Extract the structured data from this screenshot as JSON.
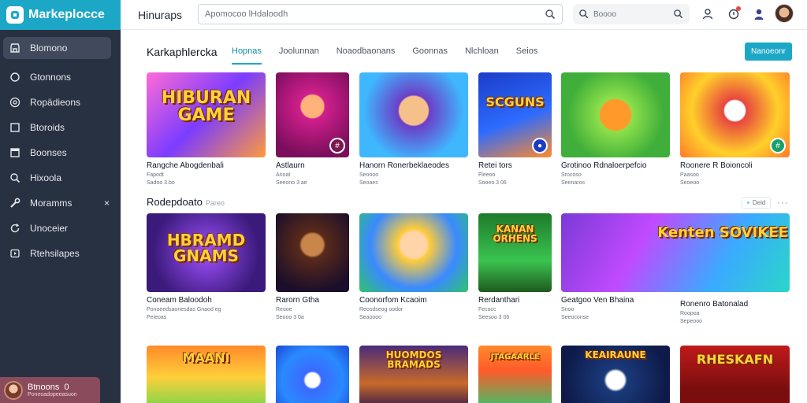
{
  "brand": {
    "name": "Markeplocce"
  },
  "sidebar": {
    "items": [
      {
        "label": "Blomono",
        "icon": "store-icon"
      },
      {
        "label": "Gtonnons",
        "icon": "circle-icon"
      },
      {
        "label": "Ropädieons",
        "icon": "target-icon"
      },
      {
        "label": "Btoroids",
        "icon": "square-icon"
      },
      {
        "label": "Boonses",
        "icon": "window-icon"
      },
      {
        "label": "Hixoola",
        "icon": "search-icon"
      },
      {
        "label": "Moramms",
        "icon": "wrench-icon",
        "extra": "×"
      },
      {
        "label": "Unoceier",
        "icon": "refresh-icon"
      },
      {
        "label": "Rtehsilapes",
        "icon": "play-icon"
      }
    ],
    "profile": {
      "name": "Btnoons",
      "badge": "0",
      "sub": "Poneoadopeeasuon"
    }
  },
  "topbar": {
    "title": "Hinuraps",
    "search_placeholder": "Apomocoo lHdaloodh",
    "search2_placeholder": "Boooo"
  },
  "main": {
    "title": "Karkaphlercka",
    "tabs": [
      "Hopnas",
      "Joolunnan",
      "Noaodbaonans",
      "Goonnas",
      "Nlchloan",
      "Seios"
    ],
    "action_label": "Nanoeonr",
    "section2_title": "Rodepdoato",
    "section2_sub": "Pareo",
    "section2_pill": "Deid"
  },
  "cards_row1": [
    {
      "title": "Rangche Abogdenbali",
      "sub": "Fapodt",
      "meta": "Sadoo 3.bo",
      "art": "HIBURAN GAME"
    },
    {
      "title": "Astlaurn",
      "sub": "Anoat",
      "meta": "Seeono 3 ae",
      "art": ""
    },
    {
      "title": "Hanorn Ronerbeklaeodes",
      "sub": "Seoooo",
      "meta": "Seoaes",
      "art": ""
    },
    {
      "title": "Retei tors",
      "sub": "Fleeoo",
      "meta": "Sooeo 3 06",
      "art": "SCGUNS"
    },
    {
      "title": "Grotinoo Rdnaloerpefcio",
      "sub": "Srocoso",
      "meta": "Seenaros",
      "art": ""
    },
    {
      "title": "Roonere R Boioncoli",
      "sub": "Paasoo",
      "meta": "Seoeoo",
      "art": ""
    }
  ],
  "cards_row2": [
    {
      "title": "Coneam Baloodoh",
      "sub": "Ponoeedsaonesdas Gnaod eg",
      "meta": "Peieoas",
      "art": "HBRAMD GNAMS"
    },
    {
      "title": "Rarorn Gtha",
      "sub": "Reooe",
      "meta": "Seooo 3 0a",
      "art": ""
    },
    {
      "title": "Coonorfom Kcaoim",
      "sub": "Reosdseog oodor",
      "meta": "Seaoooo",
      "art": ""
    },
    {
      "title": "Rerdanthari",
      "sub": "Fecocc",
      "meta": "Seesoo 3 06",
      "art": "KANAN ORHENS"
    },
    {
      "title": "Geatgoo Ven Bhaina",
      "sub": "Snoo",
      "meta": "Seeoconse",
      "art": "Kenten SOVIKEE"
    },
    {
      "title": "Ronenro Batonalad",
      "sub": "Roopoa",
      "meta": "Sepeooo",
      "art": ""
    }
  ],
  "cards_row3": [
    {
      "art": "MAANI"
    },
    {
      "art": ""
    },
    {
      "art": "HUOMDOS BRAMADS"
    },
    {
      "art": "JTAGAARLE"
    },
    {
      "art": "KEAIRAUNE"
    },
    {
      "art": "RHESKAFN"
    }
  ],
  "colors": {
    "accent": "#1da7c6",
    "sidebar": "#283142",
    "brand": "#1da7c6"
  }
}
